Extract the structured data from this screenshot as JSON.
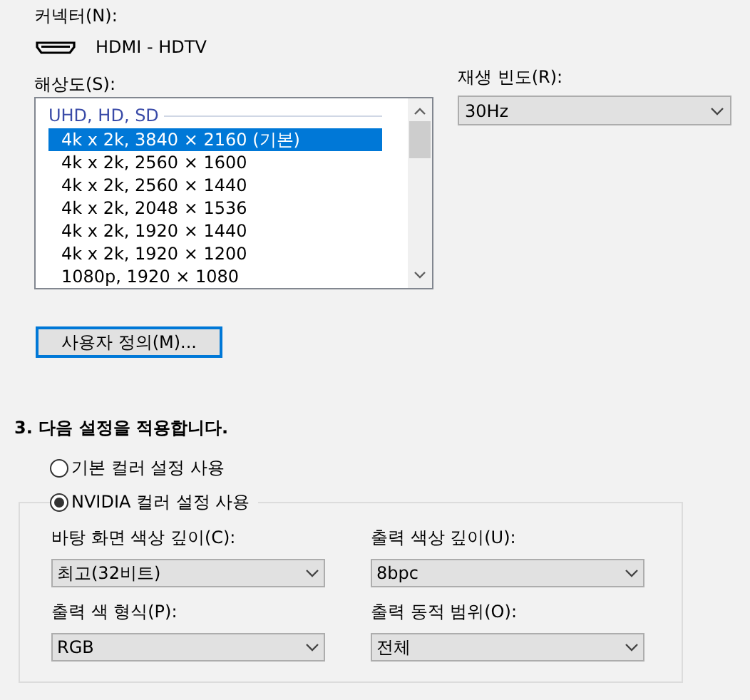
{
  "connector": {
    "label": "커넥터(N):",
    "value": "HDMI - HDTV"
  },
  "resolution": {
    "label": "해상도(S):",
    "group": "UHD, HD, SD",
    "items": [
      {
        "text": "4k x 2k, 3840 × 2160 (기본)",
        "selected": true
      },
      {
        "text": "4k x 2k, 2560 × 1600",
        "selected": false
      },
      {
        "text": "4k x 2k, 2560 × 1440",
        "selected": false
      },
      {
        "text": "4k x 2k, 2048 × 1536",
        "selected": false
      },
      {
        "text": "4k x 2k, 1920 × 1440",
        "selected": false
      },
      {
        "text": "4k x 2k, 1920 × 1200",
        "selected": false
      },
      {
        "text": "1080p, 1920 × 1080",
        "selected": false
      }
    ]
  },
  "refresh_rate": {
    "label": "재생 빈도(R):",
    "value": "30Hz"
  },
  "custom_button": "사용자 정의(M)...",
  "section": {
    "heading": "3. 다음 설정을 적용합니다.",
    "radios": [
      {
        "label": "기본 컬러 설정 사용",
        "selected": false
      },
      {
        "label": "NVIDIA 컬러 설정 사용",
        "selected": true
      }
    ],
    "fields": [
      {
        "label": "바탕 화면 색상 깊이(C):",
        "value": "최고(32비트)"
      },
      {
        "label": "출력 색상 깊이(U):",
        "value": "8bpc"
      },
      {
        "label": "출력 색 형식(P):",
        "value": "RGB"
      },
      {
        "label": "출력 동적 범위(O):",
        "value": "전체"
      }
    ]
  }
}
